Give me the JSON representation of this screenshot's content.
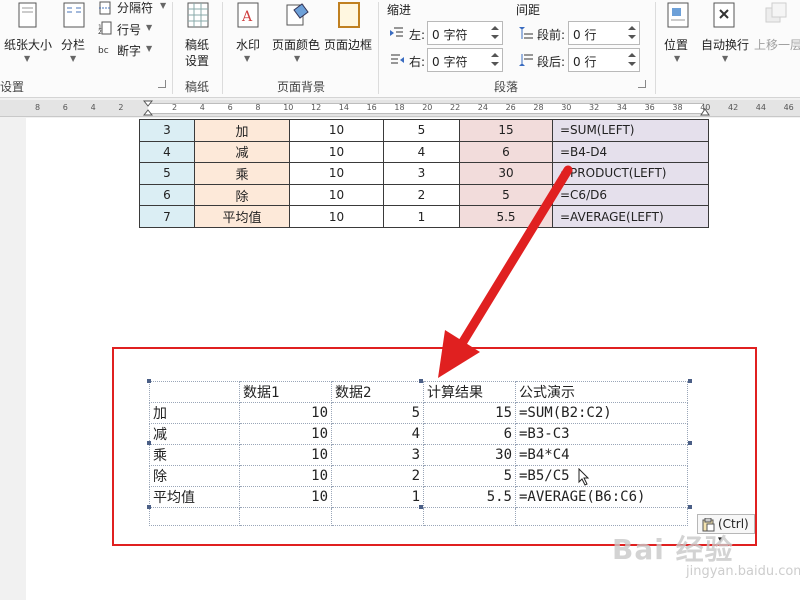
{
  "ribbon": {
    "groups": {
      "page_setup": {
        "label": "设置",
        "paper_size": "纸张大小",
        "columns": "分栏",
        "breaks": "分隔符",
        "line_numbers": "行号",
        "hyphenation": "断字"
      },
      "manuscript": {
        "label": "稿纸",
        "settings_line1": "稿纸",
        "settings_line2": "设置"
      },
      "page_background": {
        "label": "页面背景",
        "watermark": "水印",
        "page_color": "页面颜色",
        "page_borders": "页面边框"
      },
      "paragraph": {
        "label": "段落",
        "indent_title": "缩进",
        "spacing_title": "间距",
        "indent_left_label": "左:",
        "indent_left_value": "0 字符",
        "indent_right_label": "右:",
        "indent_right_value": "0 字符",
        "spacing_before_label": "段前:",
        "spacing_before_value": "0 行",
        "spacing_after_label": "段后:",
        "spacing_after_value": "0 行"
      },
      "arrange": {
        "position": "位置",
        "wrap_text": "自动换行",
        "bring_forward": "上移一层"
      }
    }
  },
  "ruler": {
    "labels": [
      "8",
      "6",
      "4",
      "2",
      "2",
      "4",
      "6",
      "8",
      "10",
      "12",
      "14",
      "16",
      "18",
      "20",
      "22",
      "24",
      "26",
      "28",
      "30",
      "32",
      "34",
      "36",
      "38",
      "40",
      "42",
      "44",
      "46"
    ]
  },
  "top_table": {
    "rows": [
      [
        "3",
        "加",
        "10",
        "5",
        "15",
        "=SUM(LEFT)"
      ],
      [
        "4",
        "减",
        "10",
        "4",
        "6",
        "=B4-D4"
      ],
      [
        "5",
        "乘",
        "10",
        "3",
        "30",
        "=PRODUCT(LEFT)"
      ],
      [
        "6",
        "除",
        "10",
        "2",
        "5",
        "=C6/D6"
      ],
      [
        "7",
        "平均值",
        "10",
        "1",
        "5.5",
        "=AVERAGE(LEFT)"
      ]
    ]
  },
  "paste_table": {
    "header": [
      "",
      "数据1",
      "数据2",
      "计算结果",
      "公式演示"
    ],
    "rows": [
      [
        "加",
        "10",
        "5",
        "15",
        "=SUM(B2:C2)"
      ],
      [
        "减",
        "10",
        "4",
        "6",
        "=B3-C3"
      ],
      [
        "乘",
        "10",
        "3",
        "30",
        "=B4*C4"
      ],
      [
        "除",
        "10",
        "2",
        "5",
        "=B5/C5"
      ],
      [
        "平均值",
        "10",
        "1",
        "5.5",
        "=AVERAGE(B6:C6)"
      ],
      [
        "",
        "",
        "",
        "",
        ""
      ]
    ]
  },
  "paste_options": {
    "label": "(Ctrl)",
    "caret": "▾"
  },
  "watermark": {
    "brand": "Bai 经验",
    "url": "jingyan.baidu.com"
  },
  "colors": {
    "callout_border": "#e02020",
    "arrow": "#e02020"
  }
}
